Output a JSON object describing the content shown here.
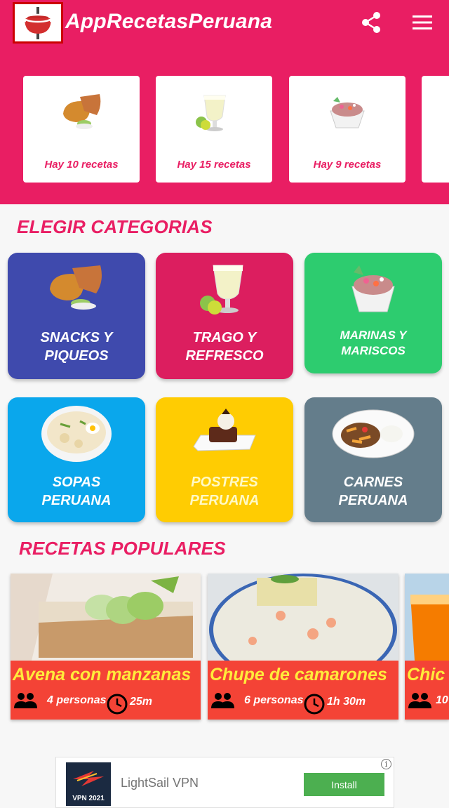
{
  "header": {
    "title": "AppRecetasPeruana"
  },
  "top_cards": [
    {
      "count": "Hay 10 recetas"
    },
    {
      "count": "Hay 15 recetas"
    },
    {
      "count": "Hay 9 recetas"
    }
  ],
  "categories_section": {
    "title": "ELEGIR CATEGORIAS"
  },
  "categories": [
    {
      "line1": "SNACKS Y",
      "line2": "PIQUEOS"
    },
    {
      "line1": "TRAGO Y",
      "line2": "REFRESCO"
    },
    {
      "line1": "MARINAS Y",
      "line2": "MARISCOS"
    },
    {
      "line1": "SOPAS",
      "line2": "PERUANA"
    },
    {
      "line1": "POSTRES",
      "line2": "PERUANA"
    },
    {
      "line1": "CARNES",
      "line2": "PERUANA"
    }
  ],
  "popular_section": {
    "title": "RECETAS POPULARES"
  },
  "popular": [
    {
      "name": "Avena con manzanas",
      "people": "4 personas",
      "time": "25m"
    },
    {
      "name": "Chupe de camarones",
      "people": "6 personas",
      "time": "1h 30m"
    },
    {
      "name": "Chic",
      "people": "10"
    }
  ],
  "ad": {
    "name": "LightSail VPN",
    "logo_text": "VPN 2021",
    "install": "Install",
    "info": "i"
  },
  "colors": {
    "header": "#e91e63",
    "snacks": "#3f4aad",
    "trago": "#dc1e5f",
    "marinas": "#2dcc6f",
    "sopas": "#0aa7ec",
    "postres": "#ffcc02",
    "carnes": "#647d8b",
    "recipe_band": "#f44336",
    "recipe_name": "#ffeb3b"
  },
  "icons": [
    "app-logo-pot-icon",
    "share-icon",
    "menu-icon",
    "people-icon",
    "clock-icon",
    "info-icon"
  ]
}
